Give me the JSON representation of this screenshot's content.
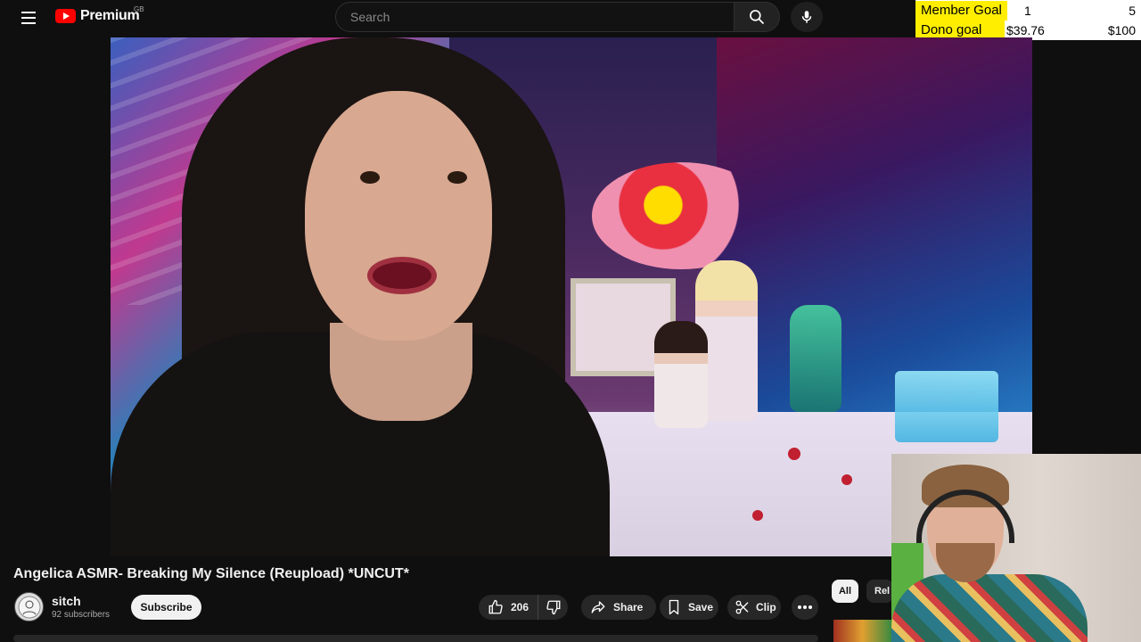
{
  "header": {
    "brand": "Premium",
    "region": "GB",
    "search_placeholder": "Search",
    "icons": {
      "menu": "hamburger-menu-icon",
      "logo": "youtube-logo-icon",
      "search": "search-icon",
      "mic": "microphone-icon"
    }
  },
  "goals": {
    "member": {
      "label": "Member Goal",
      "current": "1",
      "target": "5"
    },
    "dono": {
      "label": "Dono goal",
      "current": "$39.76",
      "target": "$100"
    },
    "colors": {
      "label_bg": "#ffee00",
      "bg": "#ffffff"
    }
  },
  "video": {
    "title": "Angelica ASMR- Breaking My Silence (Reupload) *UNCUT*",
    "channel": {
      "name": "sitch",
      "subscribers": "92 subscribers",
      "avatar_icon": "channel-avatar"
    },
    "subscribe_label": "Subscribe",
    "actions": {
      "likes": "206",
      "share": "Share",
      "save": "Save",
      "clip": "Clip"
    }
  },
  "sidebar_chips": {
    "all": "All",
    "related": "Rel"
  },
  "colors": {
    "page_bg": "#0f0f0f",
    "brand_red": "#ff0000",
    "pill_bg": "#272727"
  }
}
